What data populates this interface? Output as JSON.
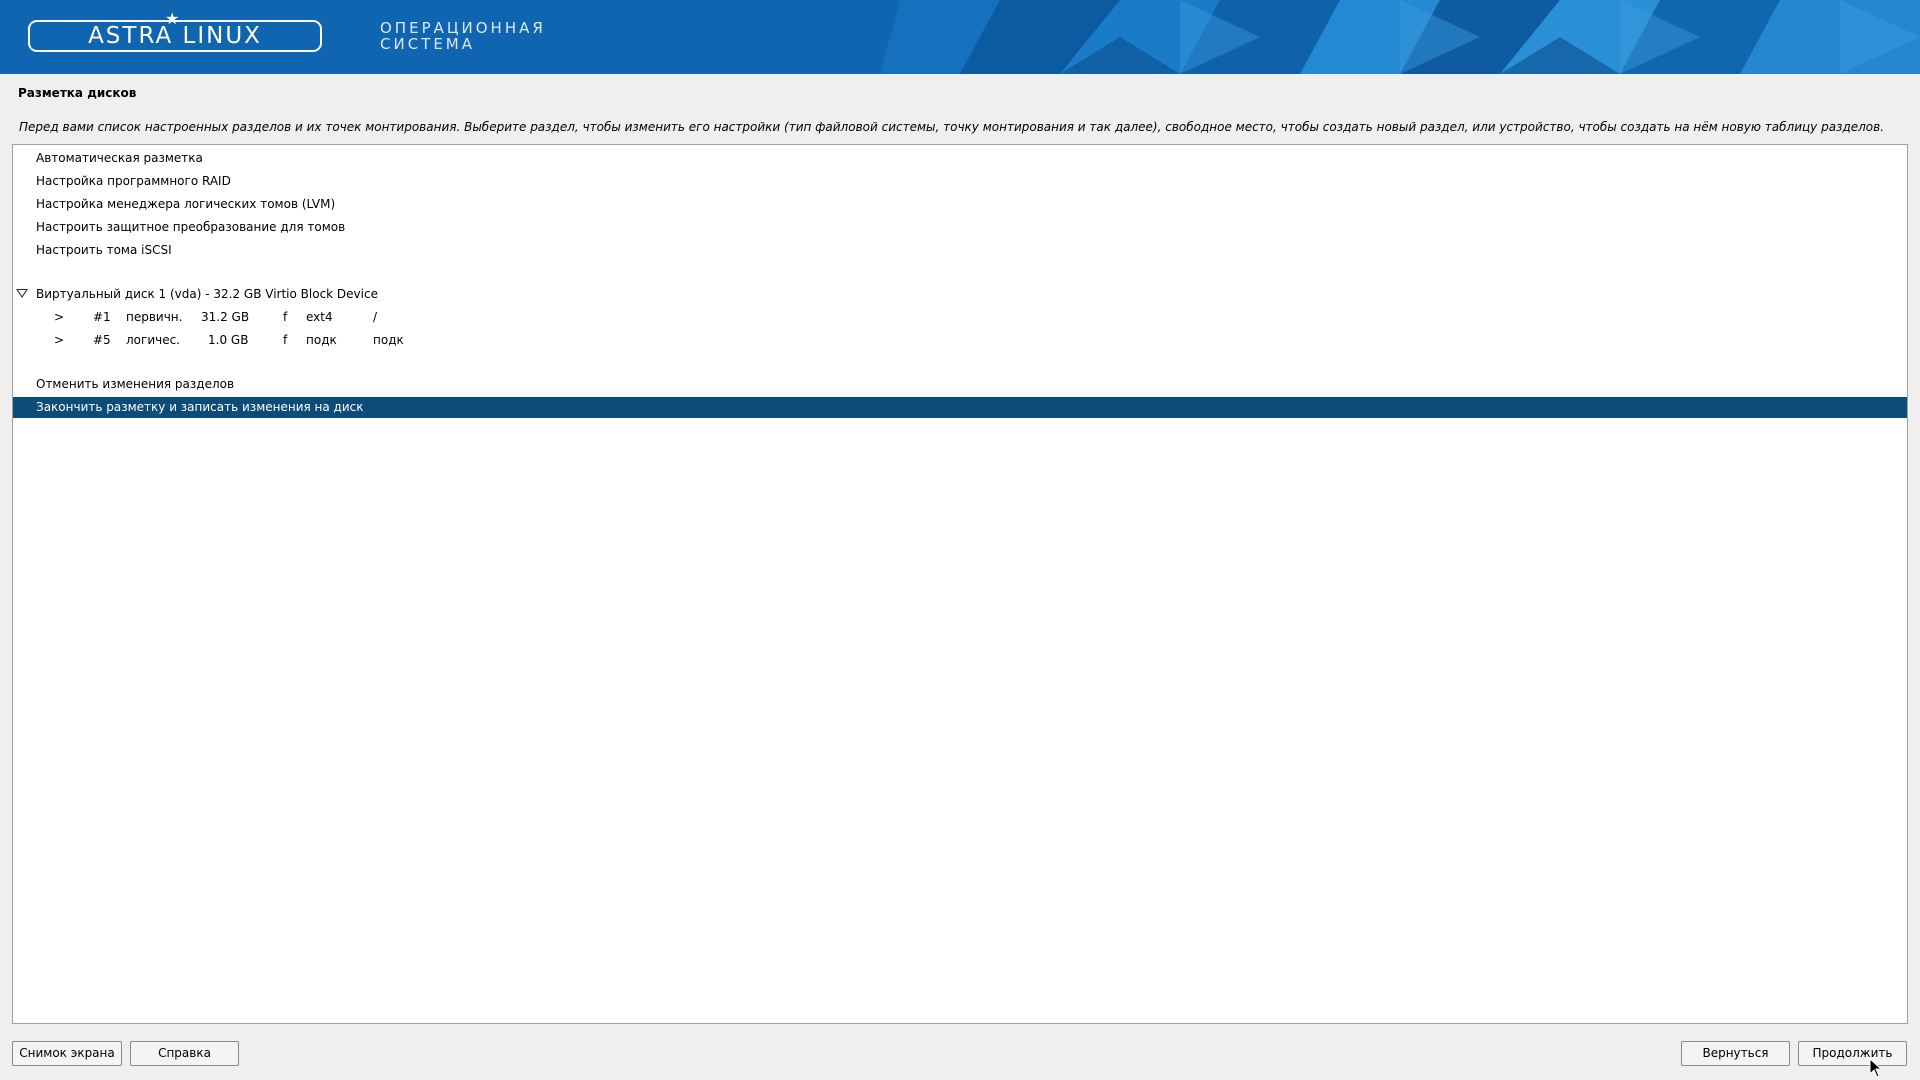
{
  "banner": {
    "logo_text": "ASTRA LINUX",
    "tagline_line1": "ОПЕРАЦИОННАЯ",
    "tagline_line2": "СИСТЕМА",
    "colors": {
      "background": "#0f65b0",
      "text": "#ffffff"
    }
  },
  "page": {
    "title": "Разметка дисков",
    "description": "Перед вами список настроенных разделов и их точек монтирования. Выберите раздел, чтобы изменить его настройки (тип файловой системы, точку монтирования и так далее), свободное место, чтобы создать новый раздел, или устройство, чтобы создать на нём новую таблицу разделов."
  },
  "list": {
    "actions": [
      {
        "label": "Автоматическая разметка"
      },
      {
        "label": "Настройка программного RAID"
      },
      {
        "label": "Настройка менеджера логических томов (LVM)"
      },
      {
        "label": "Настроить защитное преобразование для томов"
      },
      {
        "label": "Настроить тома iSCSI"
      }
    ],
    "disk": {
      "label": "Виртуальный диск 1 (vda) - 32.2 GB Virtio Block Device",
      "partitions": [
        {
          "marker": ">",
          "number": "#1",
          "type": "первичн.",
          "size": "31.2 GB",
          "flag": "f",
          "fs": "ext4",
          "mount": "/"
        },
        {
          "marker": ">",
          "number": "#5",
          "type": "логичес.",
          "size": "1.0 GB",
          "flag": "f",
          "fs": "подк",
          "mount": "подк"
        }
      ]
    },
    "undo_label": "Отменить изменения разделов",
    "finish_label": "Закончить разметку и записать изменения на диск",
    "selected_color": "#0d4c79"
  },
  "buttons": {
    "screenshot": "Снимок экрана",
    "help": "Справка",
    "back": "Вернуться",
    "continue": "Продолжить"
  }
}
